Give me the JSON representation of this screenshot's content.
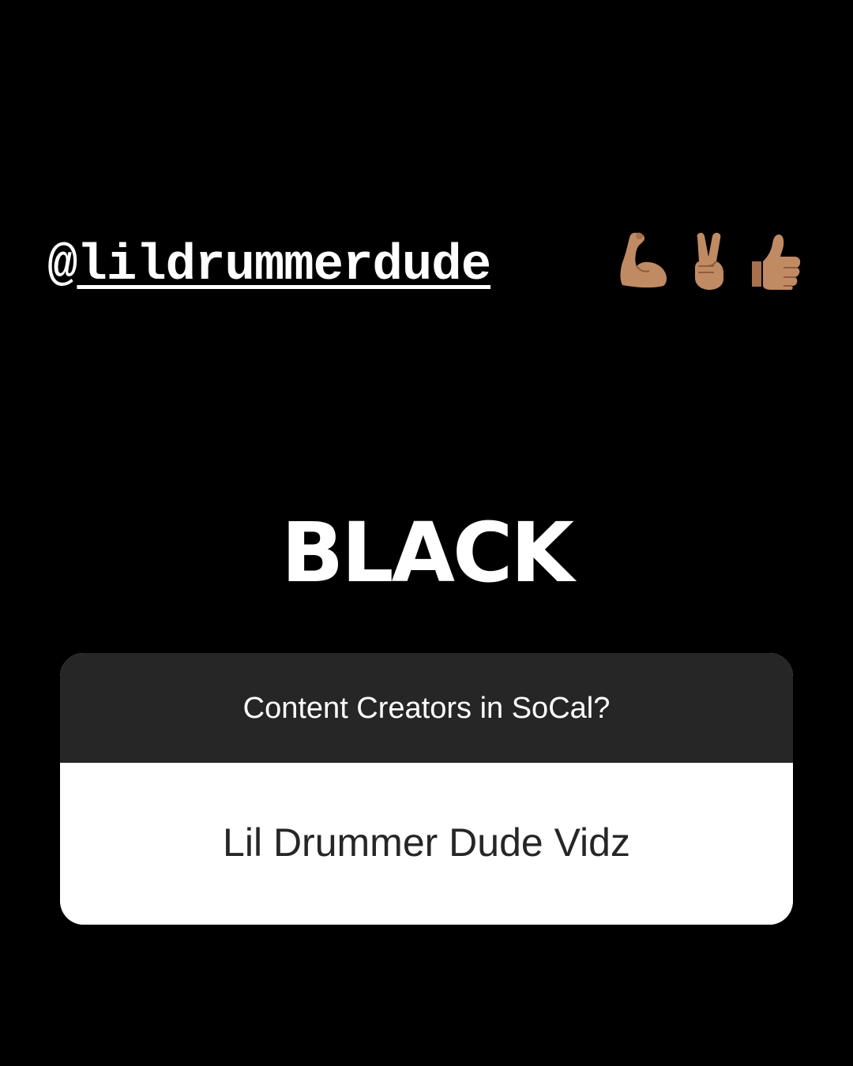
{
  "story": {
    "mention": {
      "at_symbol": "@",
      "handle": "lildrummerdude"
    },
    "emojis": [
      "flexed-biceps-icon",
      "victory-hand-icon",
      "thumbs-up-icon"
    ],
    "skin_tone_color": "#c08a63",
    "title": "BLACK",
    "question_sticker": {
      "question": "Content Creators in SoCal?",
      "answer": "Lil Drummer Dude Vidz"
    },
    "colors": {
      "background": "#000000",
      "question_bg": "#262626",
      "answer_bg": "#ffffff",
      "answer_text": "#262626"
    }
  }
}
